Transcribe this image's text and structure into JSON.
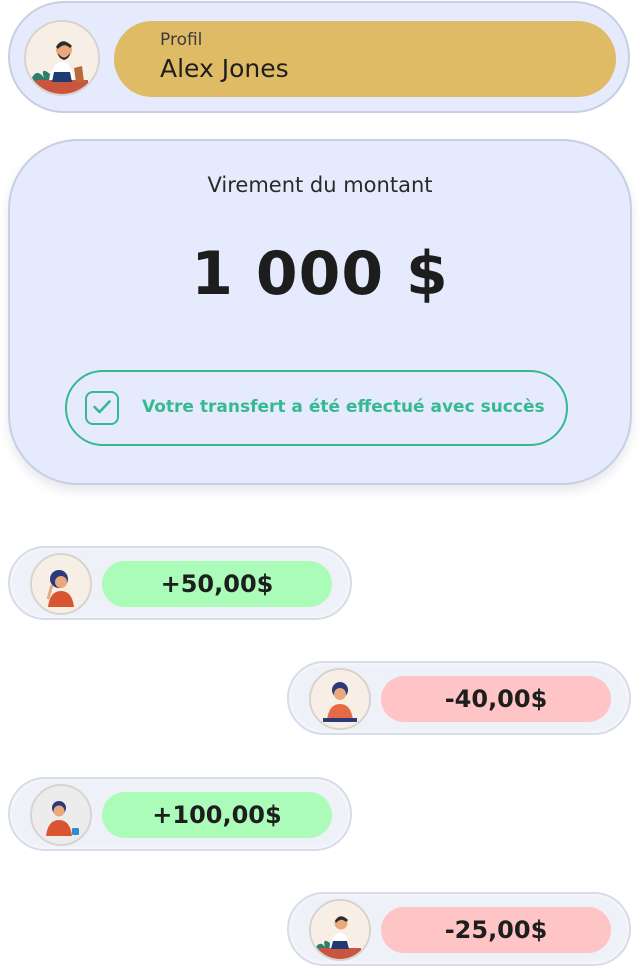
{
  "profile": {
    "label": "Profil",
    "name": "Alex Jones",
    "avatar_icon": "person-avatar-icon",
    "pill_color": "#e0bb65"
  },
  "transfer": {
    "title": "Virement du montant",
    "amount": "1 000 $",
    "success_message": "Votre transfert a été effectué avec succès",
    "success_icon": "check-icon",
    "success_color": "#37b893"
  },
  "transactions": [
    {
      "amount": "+50,00$",
      "type": "credit",
      "avatar_icon": "woman-avatar-icon"
    },
    {
      "amount": "-40,00$",
      "type": "debit",
      "avatar_icon": "woman-avatar-icon"
    },
    {
      "amount": "+100,00$",
      "type": "credit",
      "avatar_icon": "man-avatar-icon"
    },
    {
      "amount": "-25,00$",
      "type": "debit",
      "avatar_icon": "person-avatar-icon"
    }
  ],
  "colors": {
    "card_bg": "#e5ebfc",
    "credit_bg": "#abfcb9",
    "debit_bg": "#ffc4c6"
  }
}
